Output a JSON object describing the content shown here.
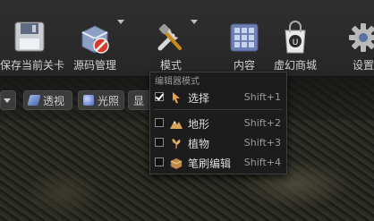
{
  "toolbar": {
    "buttons": [
      {
        "label": "保存当前关卡",
        "icon": "save-icon"
      },
      {
        "label": "源码管理",
        "icon": "source-control-icon"
      },
      {
        "label": "模式",
        "icon": "modes-tools-icon"
      },
      {
        "label": "内容",
        "icon": "content-icon"
      },
      {
        "label": "虚幻商城",
        "icon": "marketplace-icon"
      },
      {
        "label": "设置",
        "icon": "settings-icon"
      }
    ]
  },
  "viewport": {
    "perspective_label": "透视",
    "lighting_label": "光照",
    "show_label": "显"
  },
  "mode_menu": {
    "header": "编辑器模式",
    "items": [
      {
        "label": "选择",
        "shortcut": "Shift+1",
        "checked": true,
        "icon": "select-arrow-icon"
      },
      {
        "label": "地形",
        "shortcut": "Shift+2",
        "checked": false,
        "icon": "landscape-icon"
      },
      {
        "label": "植物",
        "shortcut": "Shift+3",
        "checked": false,
        "icon": "foliage-icon"
      },
      {
        "label": "笔刷编辑",
        "shortcut": "Shift+4",
        "checked": false,
        "icon": "brush-edit-icon"
      }
    ]
  }
}
